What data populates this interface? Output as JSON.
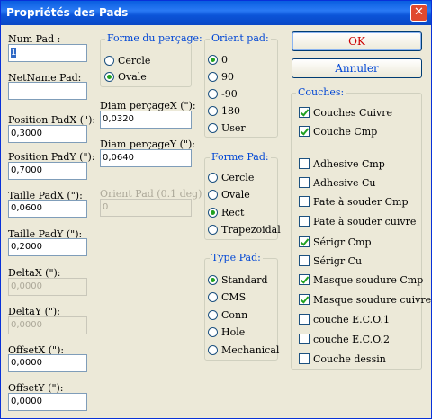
{
  "window": {
    "title": "Propriétés des Pads"
  },
  "fields": {
    "num_pad": {
      "label": "Num Pad :",
      "value": "1"
    },
    "netname": {
      "label": "NetName Pad:",
      "value": ""
    },
    "pos_x": {
      "label": "Position PadX (\"):",
      "value": "0,3000"
    },
    "pos_y": {
      "label": "Position PadY (\"):",
      "value": "0,7000"
    },
    "size_x": {
      "label": "Taille PadX (\"):",
      "value": "0,0600"
    },
    "size_y": {
      "label": "Taille PadY (\"):",
      "value": "0,2000"
    },
    "delta_x": {
      "label": "DeltaX (\"):",
      "value": "0,0000"
    },
    "delta_y": {
      "label": "DeltaY (\"):",
      "value": "0,0000"
    },
    "offset_x": {
      "label": "OffsetX (\"):",
      "value": "0,0000"
    },
    "offset_y": {
      "label": "OffsetY (\"):",
      "value": "0,0000"
    },
    "drill_x": {
      "label": "Diam perçageX (\"):",
      "value": "0,0320"
    },
    "drill_y": {
      "label": "Diam perçageY (\"):",
      "value": "0,0640"
    },
    "orient": {
      "label": "Orient Pad (0.1 deg)",
      "value": "0"
    }
  },
  "drill_shape": {
    "title": "Forme du perçage:",
    "options": [
      "Cercle",
      "Ovale"
    ],
    "selected": "Ovale"
  },
  "orient_pad": {
    "title": "Orient pad:",
    "options": [
      "0",
      "90",
      "-90",
      "180",
      "User"
    ],
    "selected": "0"
  },
  "pad_shape": {
    "title": "Forme Pad:",
    "options": [
      "Cercle",
      "Ovale",
      "Rect",
      "Trapezoidal"
    ],
    "selected": "Rect"
  },
  "pad_type": {
    "title": "Type Pad:",
    "options": [
      "Standard",
      "CMS",
      "Conn",
      "Hole",
      "Mechanical"
    ],
    "selected": "Standard"
  },
  "buttons": {
    "ok": "OK",
    "cancel": "Annuler"
  },
  "layers": {
    "title": "Couches:",
    "items": [
      {
        "label": "Couches Cuivre",
        "checked": true
      },
      {
        "label": "Couche Cmp",
        "checked": true
      },
      {
        "label": "Adhesive Cmp",
        "checked": false
      },
      {
        "label": "Adhesive Cu",
        "checked": false
      },
      {
        "label": "Pate à souder Cmp",
        "checked": false
      },
      {
        "label": "Pate à souder cuivre",
        "checked": false
      },
      {
        "label": "Sérigr Cmp",
        "checked": true
      },
      {
        "label": "Sérigr Cu",
        "checked": false
      },
      {
        "label": "Masque soudure Cmp",
        "checked": true
      },
      {
        "label": "Masque soudure cuivre",
        "checked": true
      },
      {
        "label": "couche E.C.O.1",
        "checked": false
      },
      {
        "label": "couche E.C.O.2",
        "checked": false
      },
      {
        "label": "Couche dessin",
        "checked": false
      }
    ]
  }
}
